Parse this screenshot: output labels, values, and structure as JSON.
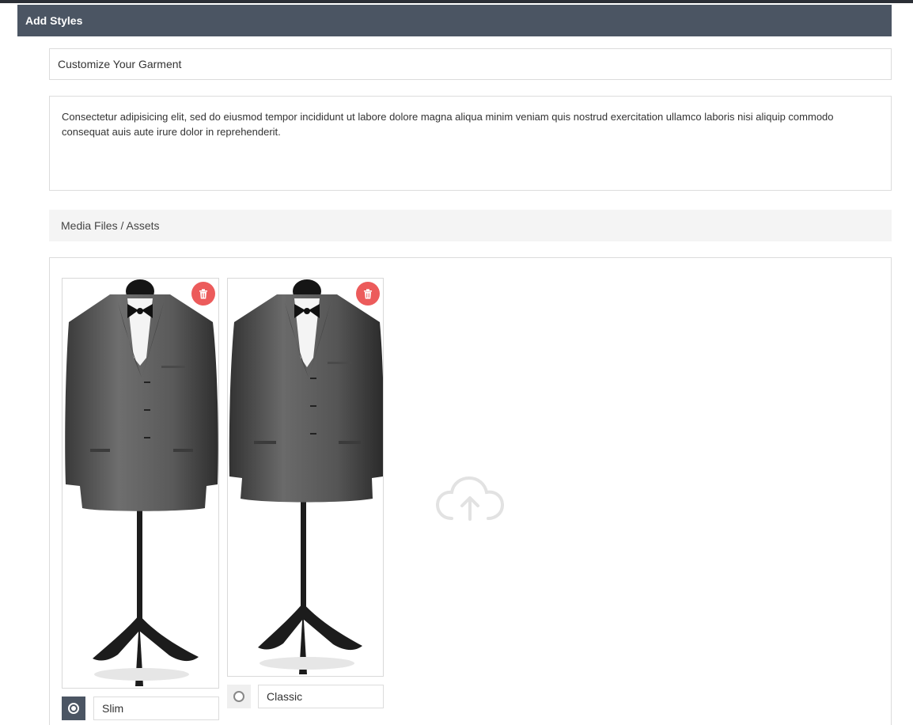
{
  "panel": {
    "title": "Add Styles"
  },
  "form": {
    "title_value": "Customize Your Garment",
    "description_value": "Consectetur adipisicing elit, sed do eiusmod tempor incididunt ut labore dolore magna aliqua minim veniam quis nostrud exercitation ullamco laboris nisi aliquip commodo consequat auis aute irure dolor in reprehenderit."
  },
  "media": {
    "section_label": "Media Files / Assets",
    "upload_icon": "cloud-upload-icon",
    "items": [
      {
        "name": "Slim",
        "selected": true,
        "delete_icon": "trash-icon",
        "image": "suit-on-mannequin"
      },
      {
        "name": "Classic",
        "selected": false,
        "delete_icon": "trash-icon",
        "image": "suit-on-mannequin"
      }
    ]
  },
  "colors": {
    "header_bg": "#4b5563",
    "delete_red": "#ec5b5b",
    "border": "#dcdcdc",
    "section_bg": "#f4f4f4"
  }
}
